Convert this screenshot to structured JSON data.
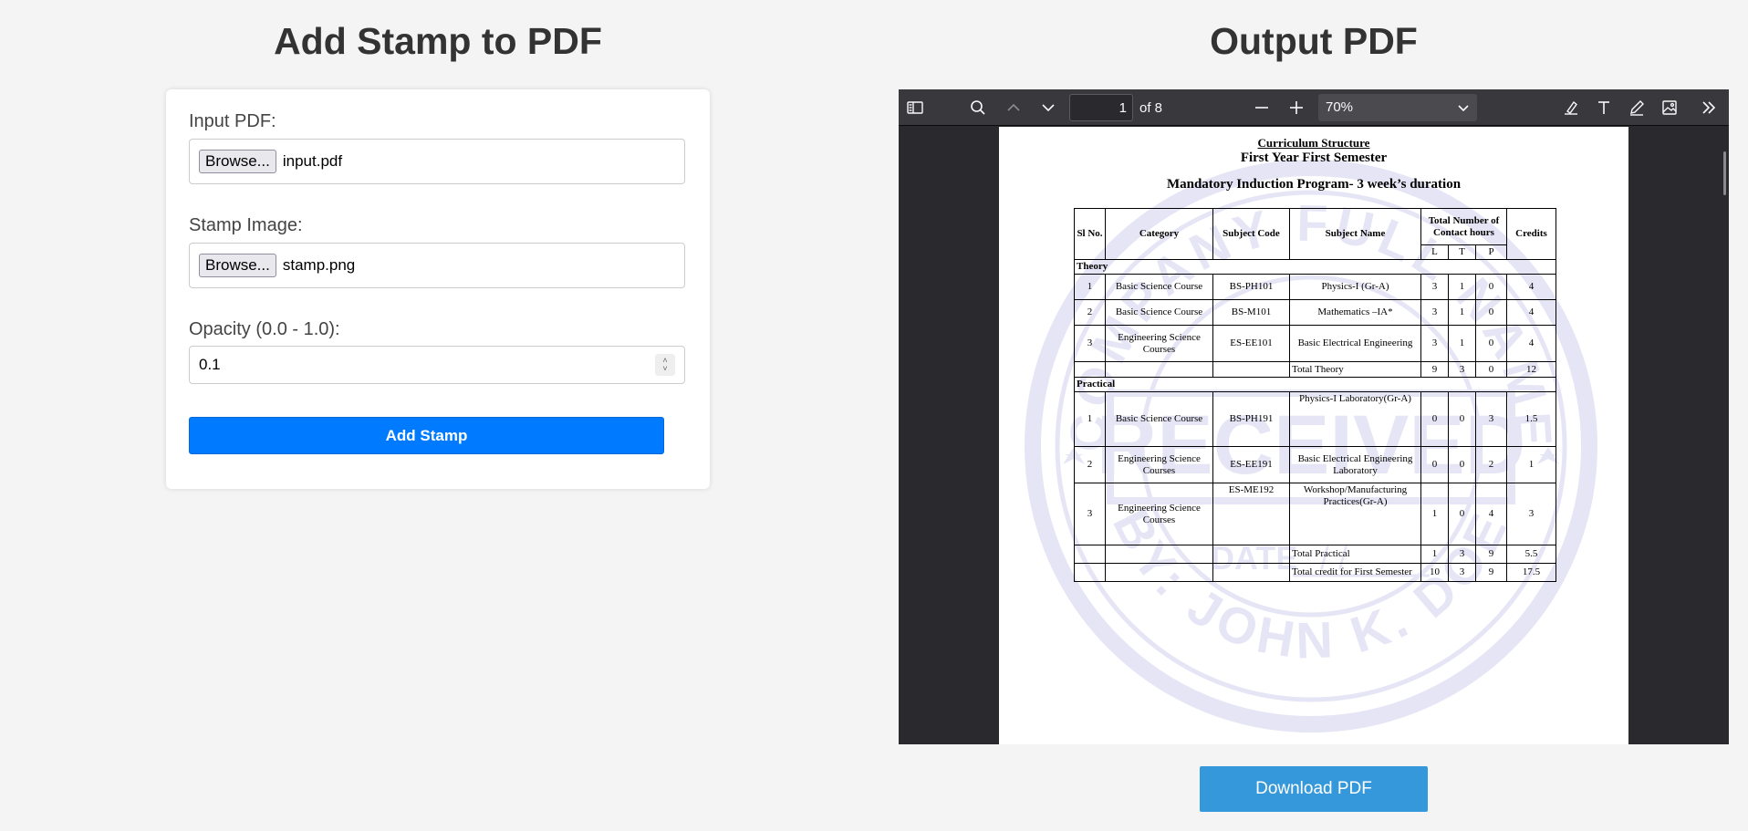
{
  "form": {
    "title": "Add Stamp to PDF",
    "input_pdf_label": "Input PDF:",
    "input_pdf_browse": "Browse...",
    "input_pdf_file": "input.pdf",
    "stamp_label": "Stamp Image:",
    "stamp_browse": "Browse...",
    "stamp_file": "stamp.png",
    "opacity_label": "Opacity (0.0 - 1.0):",
    "opacity_value": "0.1",
    "add_button": "Add Stamp"
  },
  "output": {
    "title": "Output PDF",
    "download_button": "Download PDF"
  },
  "viewer": {
    "page_number": "1",
    "page_of": "of 8",
    "zoom": "70%",
    "icons": [
      "sidebar-toggle-icon",
      "search-icon",
      "chevron-up-icon",
      "chevron-down-icon",
      "zoom-out-icon",
      "zoom-in-icon",
      "highlight-icon",
      "text-tool-icon",
      "draw-icon",
      "image-icon",
      "tools-menu-icon"
    ]
  },
  "document": {
    "heading1": "Curriculum Structure",
    "heading2": "First Year First Semester",
    "heading3": "Mandatory Induction Program- 3 week’s duration",
    "headers": {
      "sl": "Sl No.",
      "category": "Category",
      "code": "Subject Code",
      "name": "Subject Name",
      "hours": "Total Number of Contact hours",
      "credits": "Credits",
      "l": "L",
      "t": "T",
      "p": "P"
    },
    "theory_label": "Theory",
    "practical_label": "Practical",
    "rows": [
      {
        "sl": "1",
        "category": "Basic Science Course",
        "code": "BS-PH101",
        "name": "Physics-I (Gr-A)",
        "l": "3",
        "t": "1",
        "p": "0",
        "credits": "4"
      },
      {
        "sl": "2",
        "category": "Basic Science Course",
        "code": "BS-M101",
        "name": "Mathematics –IA*",
        "l": "3",
        "t": "1",
        "p": "0",
        "credits": "4"
      },
      {
        "sl": "3",
        "category": "Engineering Science Courses",
        "code": "ES-EE101",
        "name": "Basic Electrical Engineering",
        "l": "3",
        "t": "1",
        "p": "0",
        "credits": "4"
      },
      {
        "sl": "",
        "category": "",
        "code": "",
        "name": "Total Theory",
        "l": "9",
        "t": "3",
        "p": "0",
        "credits": "12"
      },
      {
        "sl": "1",
        "category": "Basic Science Course",
        "code": "BS-PH191",
        "name": "Physics-I Laboratory(Gr-A)",
        "l": "0",
        "t": "0",
        "p": "3",
        "credits": "1.5"
      },
      {
        "sl": "2",
        "category": "Engineering Science Courses",
        "code": "ES-EE191",
        "name": "Basic Electrical Engineering Laboratory",
        "l": "0",
        "t": "0",
        "p": "2",
        "credits": "1"
      },
      {
        "sl": "3",
        "category": "Engineering Science Courses",
        "code": "ES-ME192",
        "name": "Workshop/Manufacturing Practices(Gr-A)",
        "l": "1",
        "t": "0",
        "p": "4",
        "credits": "3"
      },
      {
        "sl": "",
        "category": "",
        "code": "",
        "name": "Total Practical",
        "l": "1",
        "t": "3",
        "p": "9",
        "credits": "5.5"
      },
      {
        "sl": "",
        "category": "",
        "code": "",
        "name": "Total credit for First Semester",
        "l": "10",
        "t": "3",
        "p": "9",
        "credits": "17.5"
      }
    ],
    "stamp": {
      "top_text": "COMPANY FULL NAME",
      "bottom_text": "BY: JOHN K. DOE",
      "center_text": "RECEIVED",
      "date_label": "DATE",
      "date_slashes": "/    /",
      "color": "#1a1aa8"
    }
  },
  "colors": {
    "primary_button": "#007bff",
    "download_button": "#3498db",
    "viewer_toolbar": "#38383d",
    "viewer_background": "#2a2a2e"
  }
}
